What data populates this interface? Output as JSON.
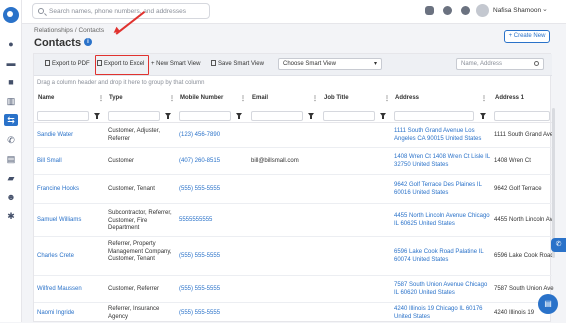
{
  "topbar": {
    "search_placeholder": "Search names, phone numbers, and addresses",
    "username": "Nafisa Shamoon"
  },
  "page": {
    "breadcrumb": "Relationships / Contacts",
    "title": "Contacts",
    "create_label": "+ Create New"
  },
  "toolbar": {
    "export_pdf": "Export to PDF",
    "export_excel": "Export to Excel",
    "new_smart_view": "+ New Smart View",
    "save_smart_view": "Save Smart View",
    "choose_smart_view": "Choose Smart View",
    "name_filter_placeholder": "Name, Address"
  },
  "group_hint": "Drag a column header and drop it here to group by that column",
  "columns": [
    "Name",
    "Type",
    "Mobile Number",
    "Email",
    "Job Title",
    "Address",
    "Address 1"
  ],
  "rows": [
    {
      "name": "Sandie Water",
      "type": "Customer, Adjuster, Referrer",
      "mobile": "(123) 456-7890",
      "email": "",
      "job": "",
      "address": "1111 South Grand Avenue Los Angeles CA 90015 United States",
      "address1": "1111 South Grand Ave"
    },
    {
      "name": "Bill Small",
      "type": "Customer",
      "mobile": "(407) 260-8515",
      "email": "bill@billsmall.com",
      "job": "",
      "address": "1408 Wren Ct 1408 Wren Ct Lisle IL 32750 United States",
      "address1": "1408 Wren Ct"
    },
    {
      "name": "Francine Hooks",
      "type": "Customer, Tenant",
      "mobile": "(555) 555-5555",
      "email": "",
      "job": "",
      "address": "9642 Golf Terrace Des Plaines IL 60016 United States",
      "address1": "9642 Golf Terrace"
    },
    {
      "name": "Samuel Williams",
      "type": "Subcontractor, Referrer, Customer, Fire Department",
      "mobile": "5555555555",
      "email": "",
      "job": "",
      "address": "4455 North Lincoln Avenue Chicago IL 60625 United States",
      "address1": "4455 North Lincoln Av"
    },
    {
      "name": "Charles Crete",
      "type": "Referrer, Property Management Company, Customer, Tenant",
      "mobile": "(555) 555-5555",
      "email": "",
      "job": "",
      "address": "6596 Lake Cook Road Palatine IL 60074 United States",
      "address1": "6596 Lake Cook Road"
    },
    {
      "name": "Wilfred Maussen",
      "type": "Customer, Referrer",
      "mobile": "(555) 555-5555",
      "email": "",
      "job": "",
      "address": "7587 South Union Avenue Chicago IL 60620 United States",
      "address1": "7587 South Union Ave"
    },
    {
      "name": "Naomi Ingride",
      "type": "Referrer, Insurance Agency",
      "mobile": "(555) 555-5555",
      "email": "",
      "job": "",
      "address": "4240 Illinois 19 Chicago IL 60176 United States",
      "address1": "4240 Illinois 19"
    }
  ],
  "colors": {
    "accent": "#2a72c9",
    "highlight": "#e0322f"
  }
}
